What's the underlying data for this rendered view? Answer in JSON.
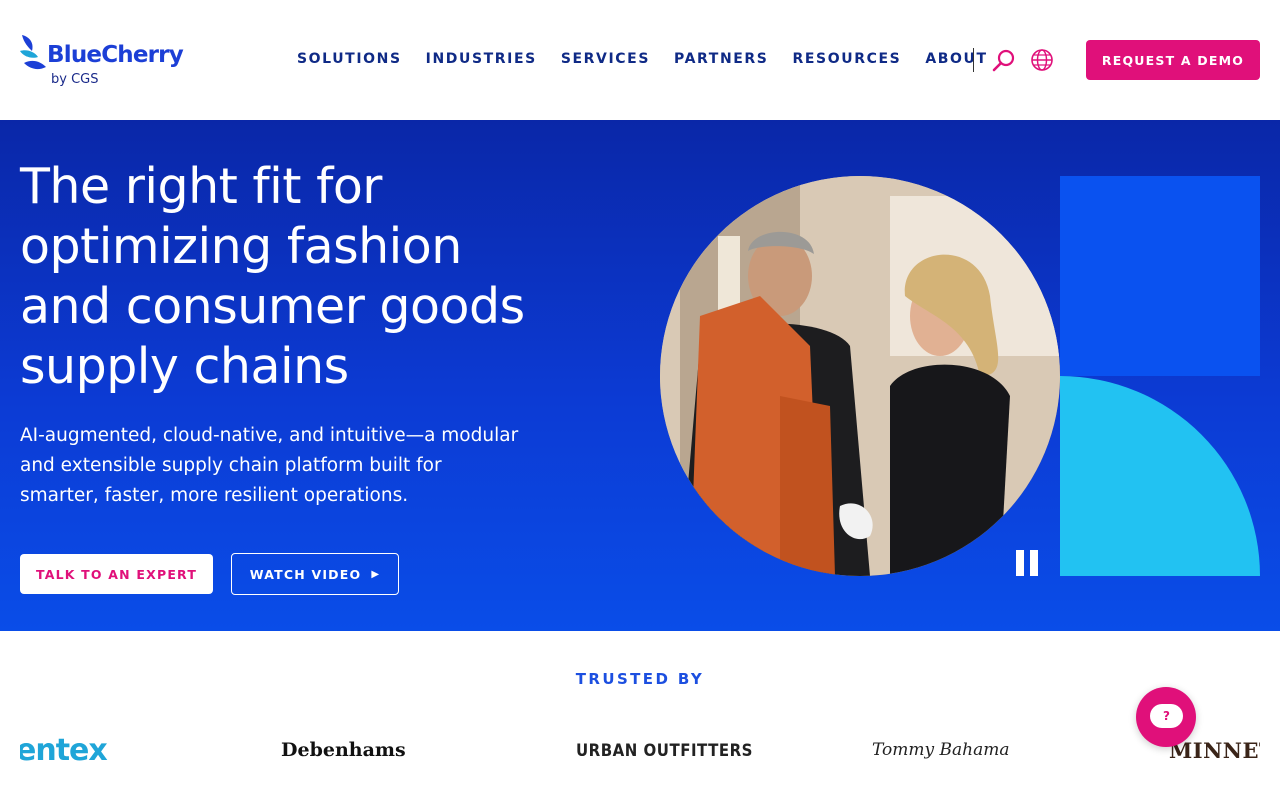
{
  "brand": {
    "name": "BlueCherry",
    "sub": "by CGS"
  },
  "nav": {
    "items": [
      "SOLUTIONS",
      "INDUSTRIES",
      "SERVICES",
      "PARTNERS",
      "RESOURCES",
      "ABOUT"
    ],
    "search_icon": "search-icon",
    "globe_icon": "globe-icon",
    "demo_label": "REQUEST A DEMO"
  },
  "hero": {
    "title": "The right fit for optimizing fashion and consumer goods supply chains",
    "subtitle": "AI-augmented, cloud-native, and intuitive—a modular and extensible supply chain platform built for smarter, faster, more resilient operations.",
    "expert_label": "TALK TO AN EXPERT",
    "video_label": "WATCH VIDEO",
    "video_icon": "▶"
  },
  "trusted": {
    "heading": "TRUSTED BY",
    "logos": [
      "entex",
      "Debenhams",
      "URBAN OUTFITTERS",
      "Tommy Bahama",
      "MINNETON"
    ]
  },
  "chat": {
    "label": "?"
  },
  "colors": {
    "primary": "#0f2a86",
    "accent": "#e0107a",
    "hero_blue": "#0c3bd4",
    "cyan": "#22c2f2"
  }
}
